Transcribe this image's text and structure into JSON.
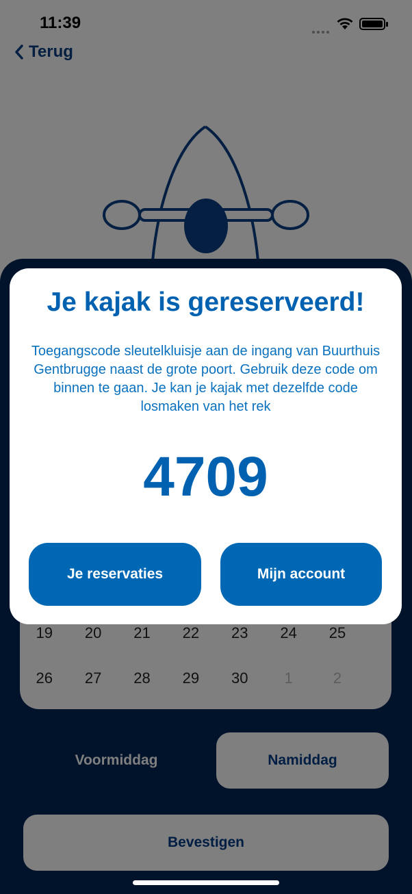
{
  "status_bar": {
    "time": "11:39"
  },
  "nav": {
    "back_label": "Terug"
  },
  "calendar": {
    "rows": [
      [
        "19",
        "20",
        "21",
        "22",
        "23",
        "24",
        "25"
      ],
      [
        "26",
        "27",
        "28",
        "29",
        "30",
        "1",
        "2"
      ]
    ]
  },
  "time_slots": {
    "morning": "Voormiddag",
    "afternoon": "Namiddag",
    "selected": "Namiddag"
  },
  "confirm_label": "Bevestigen",
  "modal": {
    "title": "Je kajak is gereserveerd!",
    "message": "Toegangscode sleutelkluisje aan de ingang van Buurthuis Gentbrugge naast de grote poort. Gebruik deze code om binnen te gaan. Je kan je kajak met dezelfde code losmaken van het rek",
    "code": "4709",
    "reservations_button": "Je reservaties",
    "account_button": "Mijn account"
  },
  "colors": {
    "primary": "#0067b4",
    "panel": "#002757",
    "nav": "#083f83"
  }
}
